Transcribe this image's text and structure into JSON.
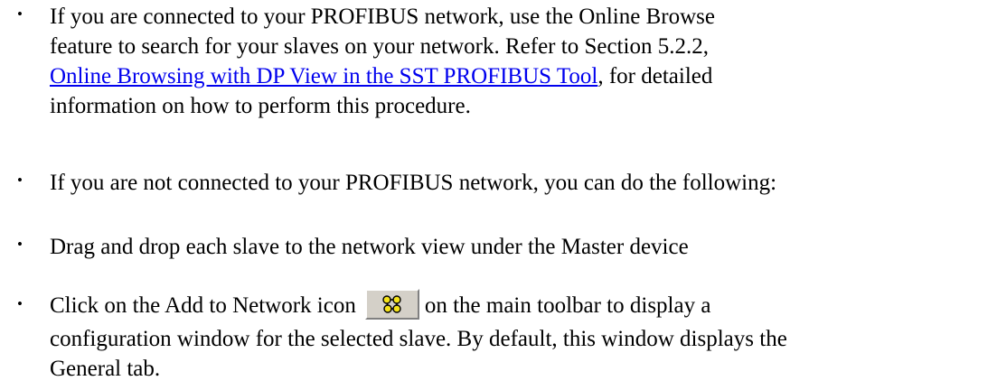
{
  "bullet_glyph": "•",
  "items": [
    {
      "lines": [
        "If you are connected to your PROFIBUS network, use the Online Browse",
        "feature to search for your slaves on your network. Refer to Section 5.2.2,"
      ],
      "link": "Online Browsing with DP View in the SST PROFIBUS Tool",
      "after_link": ", for detailed",
      "tail": "information on how to perform this procedure."
    },
    {
      "text": "If you are not connected to your PROFIBUS network, you can do the following:"
    },
    {
      "text": "Drag and drop each slave to the network view under the Master device"
    },
    {
      "before_icon": "Click on the Add to Network icon",
      "icon": "add-to-network-icon",
      "after_icon": "on the main toolbar to display a",
      "line2": "configuration window for the selected slave. By default, this window displays the",
      "line3": "General tab."
    }
  ]
}
